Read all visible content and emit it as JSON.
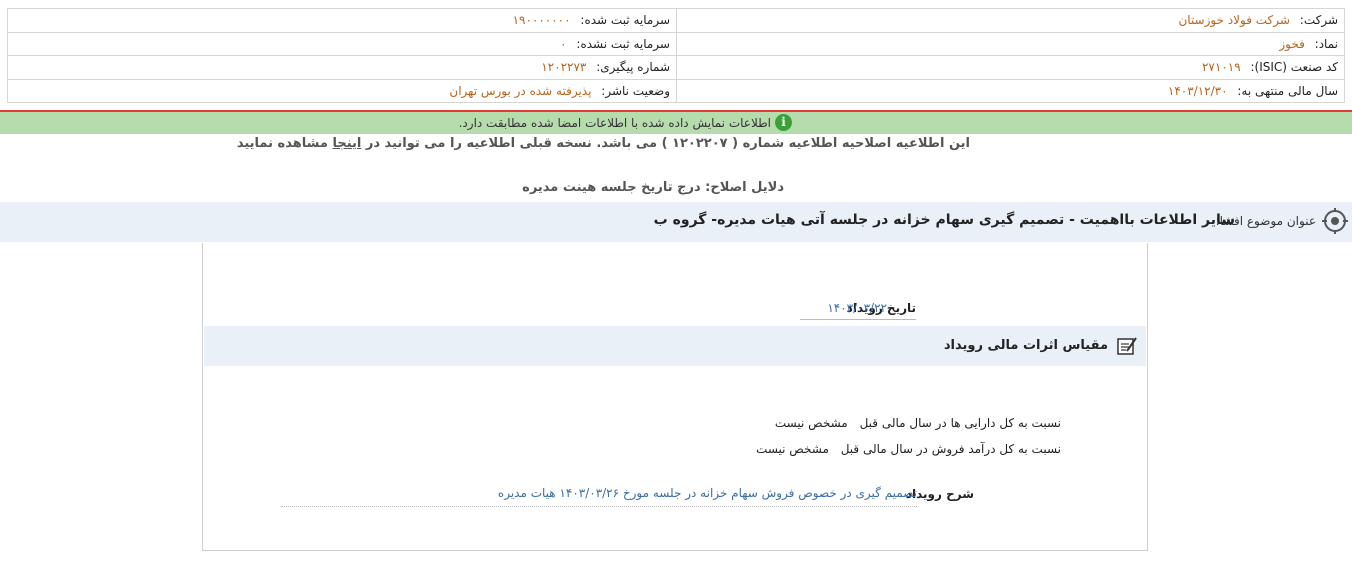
{
  "header": {
    "company_label": "شرکت:",
    "company_value": "شرکت فولاد خوزستان",
    "capital_registered_label": "سرمایه ثبت شده:",
    "capital_registered_value": "۱۹۰۰۰۰۰۰۰",
    "symbol_label": "نماد:",
    "symbol_value": "فخوز",
    "capital_unregistered_label": "سرمایه ثبت نشده:",
    "capital_unregistered_value": "۰",
    "isic_label": "کد صنعت (ISIC):",
    "isic_value": "۲۷۱۰۱۹",
    "tracking_label": "شماره پیگیری:",
    "tracking_value": "۱۲۰۲۲۷۳",
    "fiscal_label": "سال مالی منتهی به:",
    "fiscal_value": "۱۴۰۳/۱۲/۳۰",
    "status_label": "وضعیت ناشر:",
    "status_value": "پذیرفته شده در بورس تهران"
  },
  "banner": {
    "icon": "info-icon",
    "text": "اطلاعات نمایش داده شده با اطلاعات امضا شده مطابقت دارد."
  },
  "correction": {
    "text_before": "این اطلاعیه اصلاحیه اطلاعیه شماره ( ۱۲۰۲۲۰۷ ) می باشد. نسخه قبلی اطلاعیه را می توانید در",
    "link": "اینجا",
    "text_after": "مشاهده نمایید"
  },
  "reasons": "دلایل اصلاح: درج تاریخ جلسه هینت مدیره",
  "subject": {
    "icon": "target-icon",
    "label": "عنوان موضوع افشا:",
    "title": "سایر اطلاعات بااهمیت - تصمیم گیری سهام خزانه در جلسه آتی هیات مدیره- گروه ب"
  },
  "event": {
    "date_label": "تاریخ رویداد",
    "date_value": "۱۴۰۳/۰۳/۲۲"
  },
  "section": {
    "icon": "edit-icon",
    "title": "مقیاس اثرات مالی رویداد"
  },
  "ratios": [
    {
      "label": "نسبت به کل دارایی ها در سال مالی قبل",
      "value": "مشخص نیست"
    },
    {
      "label": "نسبت به کل درآمد فروش در سال مالی قبل",
      "value": "مشخص نیست"
    }
  ],
  "description": {
    "label": "شرح رویداد",
    "value": "تصمیم گیری در خصوص فروش سهام خزانه در جلسه مورخ ۱۴۰۳/۰۳/۲۶ هیات مدیره"
  }
}
